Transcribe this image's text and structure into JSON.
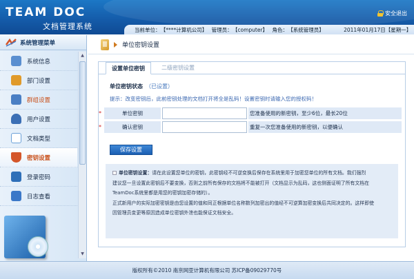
{
  "header": {
    "logo": "TEAM DOC",
    "subtitle": "文档管理系统",
    "logout": "安全退出",
    "unit_label": "当前单位：",
    "unit_value": "【****计算机公司】",
    "admin_label": "管理员：",
    "admin_value": "【computer】",
    "role_label": "角色：",
    "role_value": "【系统管理员】",
    "date": "2011年01月17日【星期一】"
  },
  "sidebar": {
    "title": "系统管理菜单",
    "items": [
      {
        "label": "系统信息",
        "icon": "document-list-icon",
        "color": "#5a8fd0"
      },
      {
        "label": "部门设置",
        "icon": "org-chart-icon",
        "color": "#e09a2a"
      },
      {
        "label": "群组设置",
        "icon": "group-users-icon",
        "color": "#4a7fc4"
      },
      {
        "label": "用户设置",
        "icon": "user-icon",
        "color": "#3b6fb5"
      },
      {
        "label": "文档类型",
        "icon": "document-type-icon",
        "color": "#6aa0d8"
      },
      {
        "label": "密钥设置",
        "icon": "shield-key-icon",
        "color": "#d4562a"
      },
      {
        "label": "登录密码",
        "icon": "monitor-login-icon",
        "color": "#2e6fb8"
      },
      {
        "label": "日志查看",
        "icon": "log-book-icon",
        "color": "#3b78c8"
      }
    ]
  },
  "main": {
    "title": "单位密钥设置",
    "tabs": [
      {
        "label": "设置单位密钥",
        "active": true
      },
      {
        "label": "二级密钥设置",
        "active": false
      }
    ],
    "section_title": "单位密钥状态",
    "section_status": "（已设置）",
    "tip": "提示：改变密钥后，此前密钥处理的文档打开将全是乱码！设置密钥时请输入您的授权码！",
    "fields": [
      {
        "label": "单位密钥",
        "value": "",
        "hint": "您准备使用的新密钥，至少6位，最长20位"
      },
      {
        "label": "确认密钥",
        "value": "",
        "hint": "重复一次您准备使用的新密钥，以便确认"
      }
    ],
    "save_button": "保存设置",
    "note": {
      "head": "单位密钥设置：",
      "line1": "请在此设置您单位的密钥，此密钥经不可逆变换后保存在系统里用于加密您单位的所有文档。我们强烈",
      "line2": "建议您一旦设置此密钥后不要变换，否则之前所有保存的文档将不能被打开（文档显示为乱码，这也侧面证明了所有文档在",
      "line3": "TeamDoc系统里都是用您的密钥加密存储的）。",
      "line4": "正式新用户的实际加密密钥是由您设置的值和同正根据单位名称数列加密出的值经不可逆算加密变换后共同决定的。这样即使",
      "line5": "因管理员变更等原因造成单位密钥外泄也能保证文档安全。"
    }
  },
  "footer": {
    "text": "版权所有©2010 南京网亚计算机有限公司 苏ICP备09029770号"
  },
  "colors": {
    "header_blue": "#145aa8",
    "accent_orange": "#c9501a",
    "button_blue": "#1b5fb3"
  }
}
